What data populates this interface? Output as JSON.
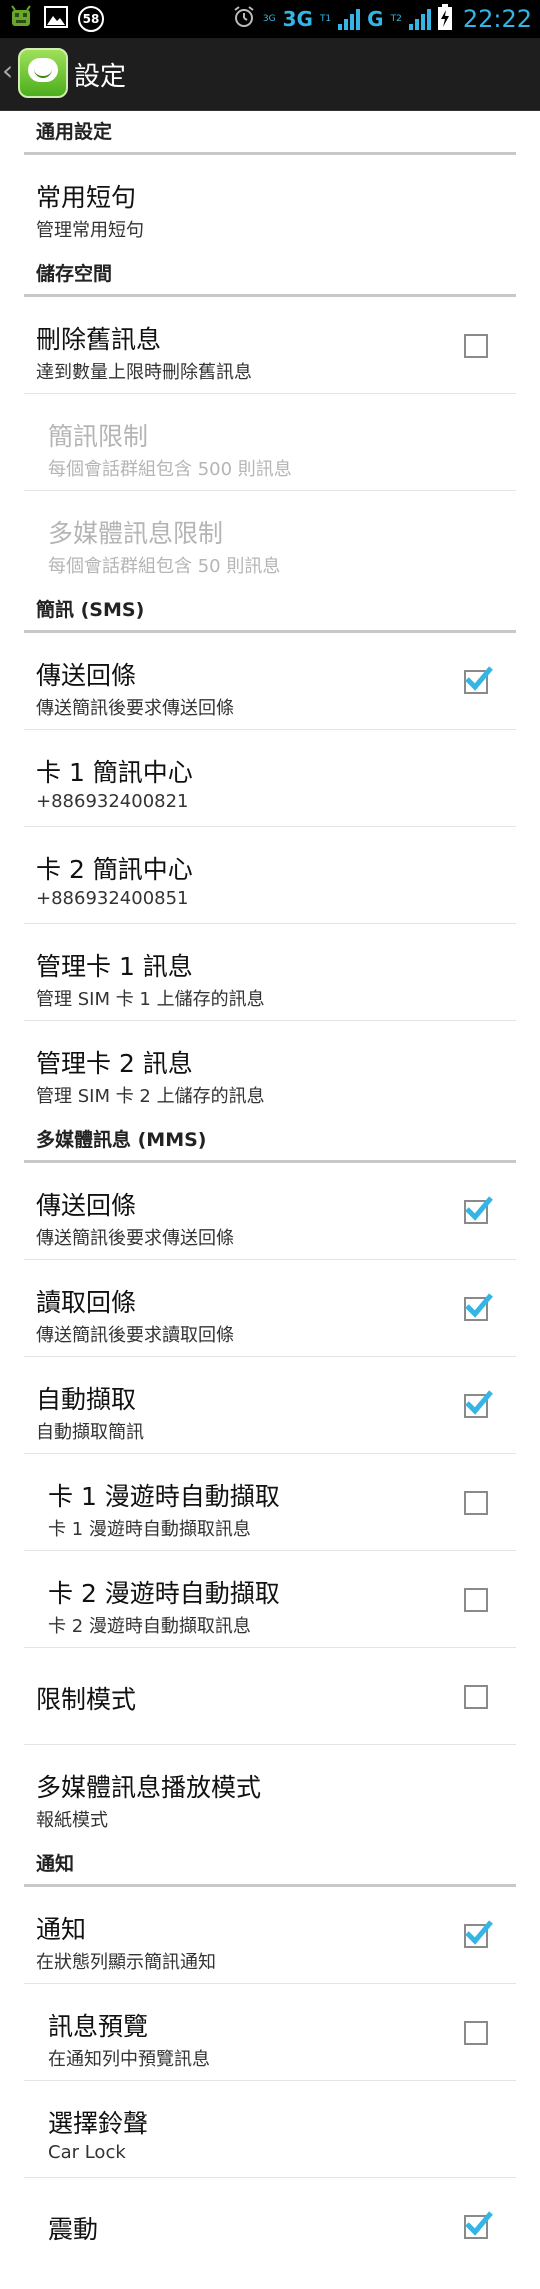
{
  "status_bar": {
    "notification_badge": "58",
    "net_left": "3G",
    "sim_left_tiny": "T1",
    "net_small_top": "3G",
    "net_right": "G",
    "sim_right_tiny": "T2",
    "time": "22:22",
    "accent_color": "#33b5e5"
  },
  "action_bar": {
    "title": "設定"
  },
  "sections": {
    "general": {
      "header": "通用設定"
    },
    "storage": {
      "header": "儲存空間"
    },
    "sms": {
      "header": "簡訊 (SMS)"
    },
    "mms": {
      "header": "多媒體訊息 (MMS)"
    },
    "notify": {
      "header": "通知"
    }
  },
  "items": {
    "quick_text": {
      "title": "常用短句",
      "summary": "管理常用短句"
    },
    "delete_old": {
      "title": "刪除舊訊息",
      "summary": "達到數量上限時刪除舊訊息",
      "checked": false
    },
    "sms_limit": {
      "title": "簡訊限制",
      "summary": "每個會話群組包含 500 則訊息"
    },
    "mms_limit": {
      "title": "多媒體訊息限制",
      "summary": "每個會話群組包含 50 則訊息"
    },
    "sms_delivery": {
      "title": "傳送回條",
      "summary": "傳送簡訊後要求傳送回條",
      "checked": true
    },
    "sim1_center": {
      "title": "卡 1 簡訊中心",
      "summary": "+886932400821"
    },
    "sim2_center": {
      "title": "卡 2 簡訊中心",
      "summary": "+886932400851"
    },
    "manage_sim1": {
      "title": "管理卡 1 訊息",
      "summary": "管理 SIM 卡 1 上儲存的訊息"
    },
    "manage_sim2": {
      "title": "管理卡 2 訊息",
      "summary": "管理 SIM 卡 2 上儲存的訊息"
    },
    "mms_delivery": {
      "title": "傳送回條",
      "summary": "傳送簡訊後要求傳送回條",
      "checked": true
    },
    "mms_read": {
      "title": "讀取回條",
      "summary": "傳送簡訊後要求讀取回條",
      "checked": true
    },
    "auto_retrieve": {
      "title": "自動擷取",
      "summary": "自動擷取簡訊",
      "checked": true
    },
    "sim1_roaming": {
      "title": "卡 1 漫遊時自動擷取",
      "summary": "卡 1 漫遊時自動擷取訊息",
      "checked": false
    },
    "sim2_roaming": {
      "title": "卡 2 漫遊時自動擷取",
      "summary": "卡 2 漫遊時自動擷取訊息",
      "checked": false
    },
    "restricted_mode": {
      "title": "限制模式",
      "checked": false
    },
    "mms_playback": {
      "title": "多媒體訊息播放模式",
      "summary": "報紙模式"
    },
    "notifications": {
      "title": "通知",
      "summary": "在狀態列顯示簡訊通知",
      "checked": true
    },
    "preview": {
      "title": "訊息預覽",
      "summary": "在通知列中預覽訊息",
      "checked": false
    },
    "ringtone": {
      "title": "選擇鈴聲",
      "summary": "Car Lock"
    },
    "vibrate": {
      "title": "震動",
      "checked": true
    }
  },
  "icons": {
    "status_left": [
      "android-bug-icon",
      "image-notification-icon",
      "count-badge-icon"
    ],
    "status_right": [
      "alarm-clock-icon",
      "signal-bars-icon",
      "battery-charging-icon"
    ],
    "back": "chevron-left-icon",
    "app": "messaging-app-icon",
    "check": "checkmark-icon"
  }
}
